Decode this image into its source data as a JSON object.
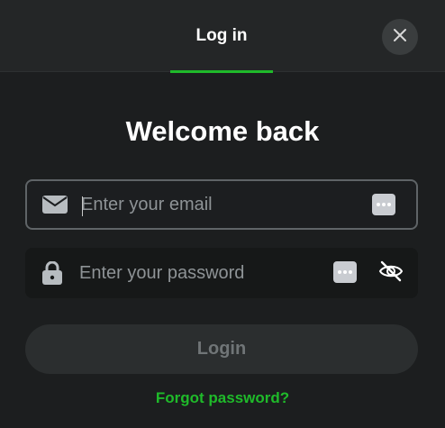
{
  "header": {
    "tab_label": "Log in",
    "close_icon": "close-icon"
  },
  "form": {
    "title": "Welcome back",
    "email": {
      "icon": "envelope-icon",
      "placeholder": "Enter your email",
      "value": ""
    },
    "password": {
      "icon": "lock-icon",
      "placeholder": "Enter your password",
      "value": "",
      "visibility_icon": "eye-off-icon"
    },
    "submit_label": "Login",
    "forgot_label": "Forgot password?"
  },
  "colors": {
    "accent": "#1fba2a",
    "background": "#1c1e1f",
    "header_background": "#242627",
    "button_disabled": "#2b2e2f"
  }
}
